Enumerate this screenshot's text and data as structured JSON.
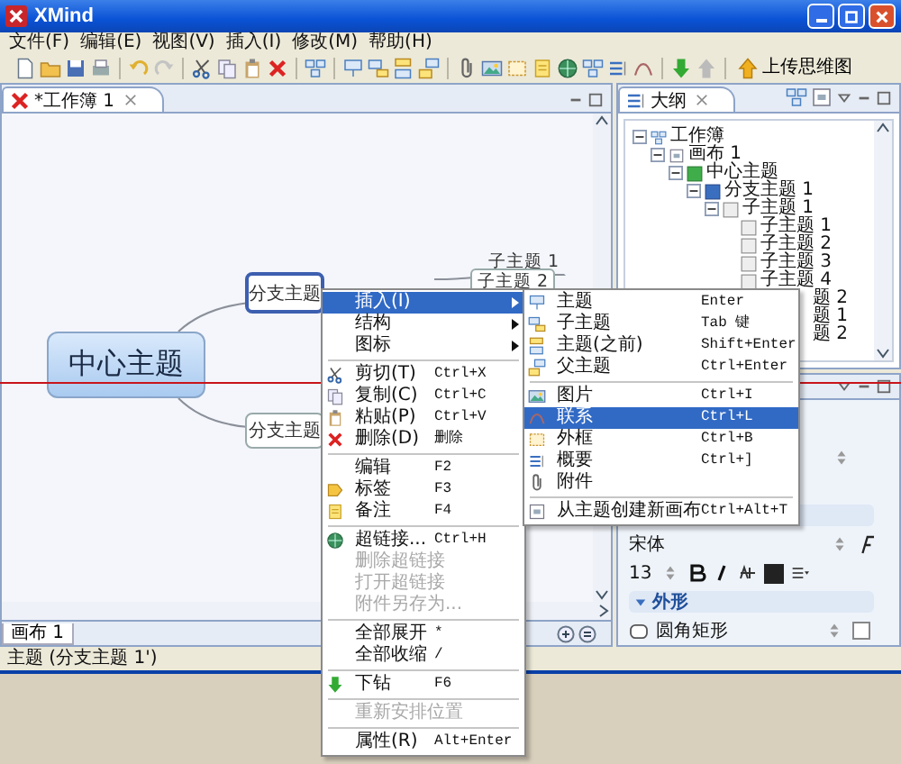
{
  "window": {
    "title": "XMind"
  },
  "menu_bar": [
    {
      "label": "文件(F)"
    },
    {
      "label": "编辑(E)"
    },
    {
      "label": "视图(V)"
    },
    {
      "label": "插入(I)"
    },
    {
      "label": "修改(M)"
    },
    {
      "label": "帮助(H)"
    }
  ],
  "toolbar": {
    "upload_button": "上传思维图"
  },
  "editor": {
    "tab": "*工作簿 1",
    "central_topic": "中心主题",
    "branches": [
      {
        "label": "分支主题",
        "selected": true
      },
      {
        "label": "分支主题",
        "selected": false
      }
    ],
    "subtopics": [
      {
        "label": "子主题 1",
        "hovered": false
      },
      {
        "label": "子主题 2",
        "hovered": true
      }
    ]
  },
  "sheet_tabs": [
    {
      "label": "画布 1",
      "selected": true
    }
  ],
  "outline": {
    "title": "大纲",
    "tree": [
      {
        "label": "工作簿",
        "expanded": true,
        "children": [
          {
            "label": "画布 1",
            "expanded": true,
            "children": [
              {
                "label": "中心主题",
                "expanded": true,
                "children": [
                  {
                    "label": "分支主题 1",
                    "expanded": true,
                    "children": [
                      {
                        "label": "子主题 1",
                        "expanded": true,
                        "children": [
                          {
                            "label": "子主题 1"
                          },
                          {
                            "label": "子主题 2"
                          },
                          {
                            "label": "子主题 3"
                          },
                          {
                            "label": "子主题 4"
                          }
                        ]
                      }
                    ]
                  }
                ]
              }
            ]
          }
        ]
      }
    ],
    "clipped_rows": [
      "题 2",
      "题 1",
      "题 2"
    ]
  },
  "properties": {
    "font": "宋体",
    "font_size": "13",
    "section": "外形",
    "section_expanded": true,
    "shape": "圆角矩形",
    "shape_checked": false
  },
  "context_menu": {
    "items": [
      {
        "kind": "item",
        "label": "插入(I)",
        "has_submenu": true,
        "selected": true,
        "disabled": false
      },
      {
        "kind": "item",
        "label": "结构",
        "has_submenu": true,
        "selected": false,
        "disabled": false
      },
      {
        "kind": "item",
        "label": "图标",
        "has_submenu": true,
        "selected": false,
        "disabled": false
      },
      {
        "kind": "separator"
      },
      {
        "kind": "item",
        "label": "剪切(T)",
        "shortcut": "Ctrl+X",
        "selected": false,
        "disabled": false
      },
      {
        "kind": "item",
        "label": "复制(C)",
        "shortcut": "Ctrl+C",
        "selected": false,
        "disabled": false
      },
      {
        "kind": "item",
        "label": "粘贴(P)",
        "shortcut": "Ctrl+V",
        "selected": false,
        "disabled": false
      },
      {
        "kind": "item",
        "label": "删除(D)",
        "shortcut": "删除",
        "selected": false,
        "disabled": false
      },
      {
        "kind": "separator"
      },
      {
        "kind": "item",
        "label": "编辑",
        "shortcut": "F2",
        "selected": false,
        "disabled": false
      },
      {
        "kind": "item",
        "label": "标签",
        "shortcut": "F3",
        "selected": false,
        "disabled": false
      },
      {
        "kind": "item",
        "label": "备注",
        "shortcut": "F4",
        "selected": false,
        "disabled": false
      },
      {
        "kind": "separator"
      },
      {
        "kind": "item",
        "label": "超链接...",
        "shortcut": "Ctrl+H",
        "selected": false,
        "disabled": false
      },
      {
        "kind": "item",
        "label": "删除超链接",
        "selected": false,
        "disabled": true
      },
      {
        "kind": "item",
        "label": "打开超链接",
        "selected": false,
        "disabled": true
      },
      {
        "kind": "item",
        "label": "附件另存为...",
        "selected": false,
        "disabled": true
      },
      {
        "kind": "separator"
      },
      {
        "kind": "item",
        "label": "全部展开",
        "shortcut": "*",
        "selected": false,
        "disabled": false
      },
      {
        "kind": "item",
        "label": "全部收缩",
        "shortcut": "/",
        "selected": false,
        "disabled": false
      },
      {
        "kind": "separator"
      },
      {
        "kind": "item",
        "label": "下钻",
        "shortcut": "F6",
        "selected": false,
        "disabled": false
      },
      {
        "kind": "separator"
      },
      {
        "kind": "item",
        "label": "重新安排位置",
        "selected": false,
        "disabled": true
      },
      {
        "kind": "separator"
      },
      {
        "kind": "item",
        "label": "属性(R)",
        "shortcut": "Alt+Enter",
        "selected": false,
        "disabled": false
      }
    ]
  },
  "submenu": {
    "items": [
      {
        "kind": "item",
        "label": "主题",
        "shortcut": "Enter",
        "selected": false,
        "disabled": false
      },
      {
        "kind": "item",
        "label": "子主题",
        "shortcut": "Tab 键",
        "selected": false,
        "disabled": false
      },
      {
        "kind": "item",
        "label": "主题(之前)",
        "shortcut": "Shift+Enter",
        "selected": false,
        "disabled": false
      },
      {
        "kind": "item",
        "label": "父主题",
        "shortcut": "Ctrl+Enter",
        "selected": false,
        "disabled": false
      },
      {
        "kind": "separator"
      },
      {
        "kind": "item",
        "label": "图片",
        "shortcut": "Ctrl+I",
        "selected": false,
        "disabled": false
      },
      {
        "kind": "item",
        "label": "联系",
        "shortcut": "Ctrl+L",
        "selected": true,
        "disabled": false
      },
      {
        "kind": "item",
        "label": "外框",
        "shortcut": "Ctrl+B",
        "selected": false,
        "disabled": false
      },
      {
        "kind": "item",
        "label": "概要",
        "shortcut": "Ctrl+]",
        "selected": false,
        "disabled": false
      },
      {
        "kind": "item",
        "label": "附件",
        "selected": false,
        "disabled": false
      },
      {
        "kind": "separator"
      },
      {
        "kind": "item",
        "label": "从主题创建新画布",
        "shortcut": "Ctrl+Alt+T",
        "selected": false,
        "disabled": false
      }
    ]
  },
  "status_bar": {
    "text": "主题 (分支主题 1')"
  }
}
